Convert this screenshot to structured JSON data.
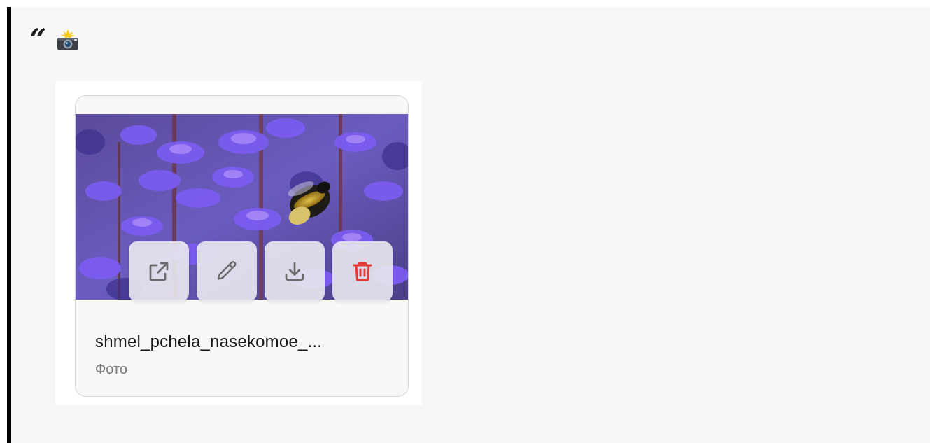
{
  "quote": {
    "mark": "“",
    "icon": "camera-flash-icon"
  },
  "attachment": {
    "file_name": "shmel_pchela_nasekomoe_...",
    "file_type": "Фото",
    "image_subject": "bumblebee-on-purple-flowers",
    "actions": [
      {
        "name": "open-in-new-window",
        "icon": "external-link-icon"
      },
      {
        "name": "edit",
        "icon": "pencil-icon"
      },
      {
        "name": "download",
        "icon": "download-icon"
      },
      {
        "name": "delete",
        "icon": "trash-icon"
      }
    ]
  },
  "colors": {
    "background": "#f7f7f7",
    "quote_bar": "#000000",
    "icon_gray": "#6b6b6b",
    "delete_red": "#e53935"
  }
}
